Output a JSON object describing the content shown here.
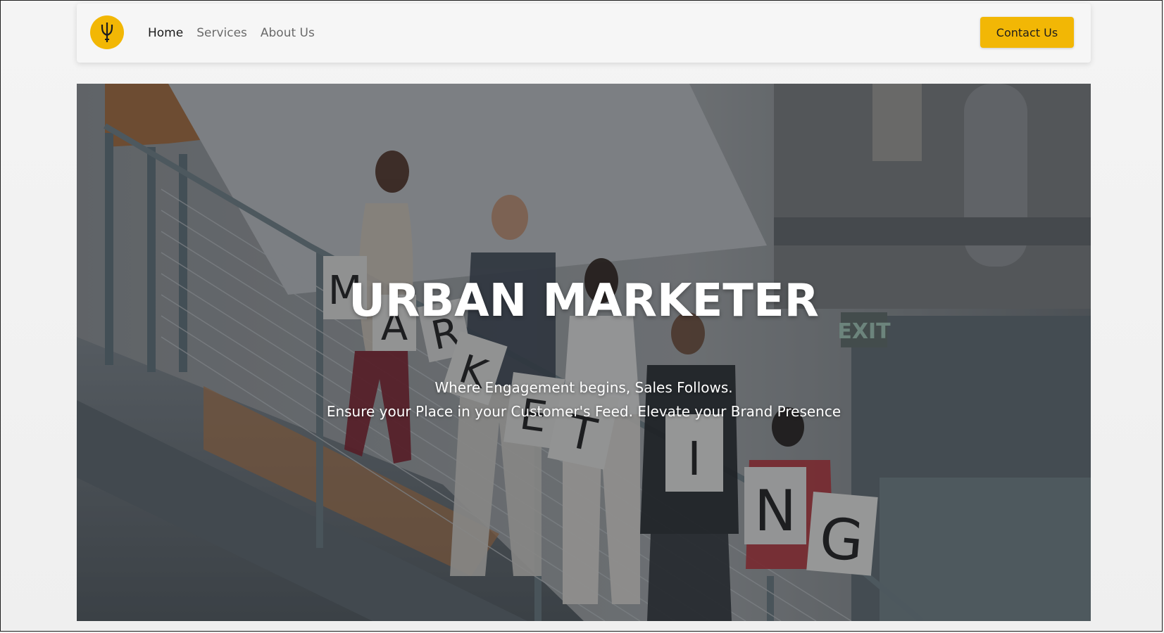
{
  "nav": {
    "logo_icon": "trident-logo-icon",
    "links": [
      {
        "label": "Home",
        "active": true
      },
      {
        "label": "Services",
        "active": false
      },
      {
        "label": "About Us",
        "active": false
      }
    ],
    "contact_label": "Contact Us"
  },
  "hero": {
    "title": "URBAN MARKETER",
    "subtitle_line1": "Where Engagement begins, Sales Follows.",
    "subtitle_line2": "Ensure your Place in your Customer's Feed. Elevate your Brand Presence",
    "sign_letters": [
      "M",
      "A",
      "R",
      "K",
      "E",
      "T",
      "I",
      "N",
      "G"
    ],
    "exit_sign": "EXIT"
  },
  "colors": {
    "accent": "#f2b705",
    "page_bg": "#f1f1f1",
    "nav_bg": "#f6f6f6",
    "text_dark": "#1a1a1a",
    "text_muted": "#6a6a6a"
  }
}
